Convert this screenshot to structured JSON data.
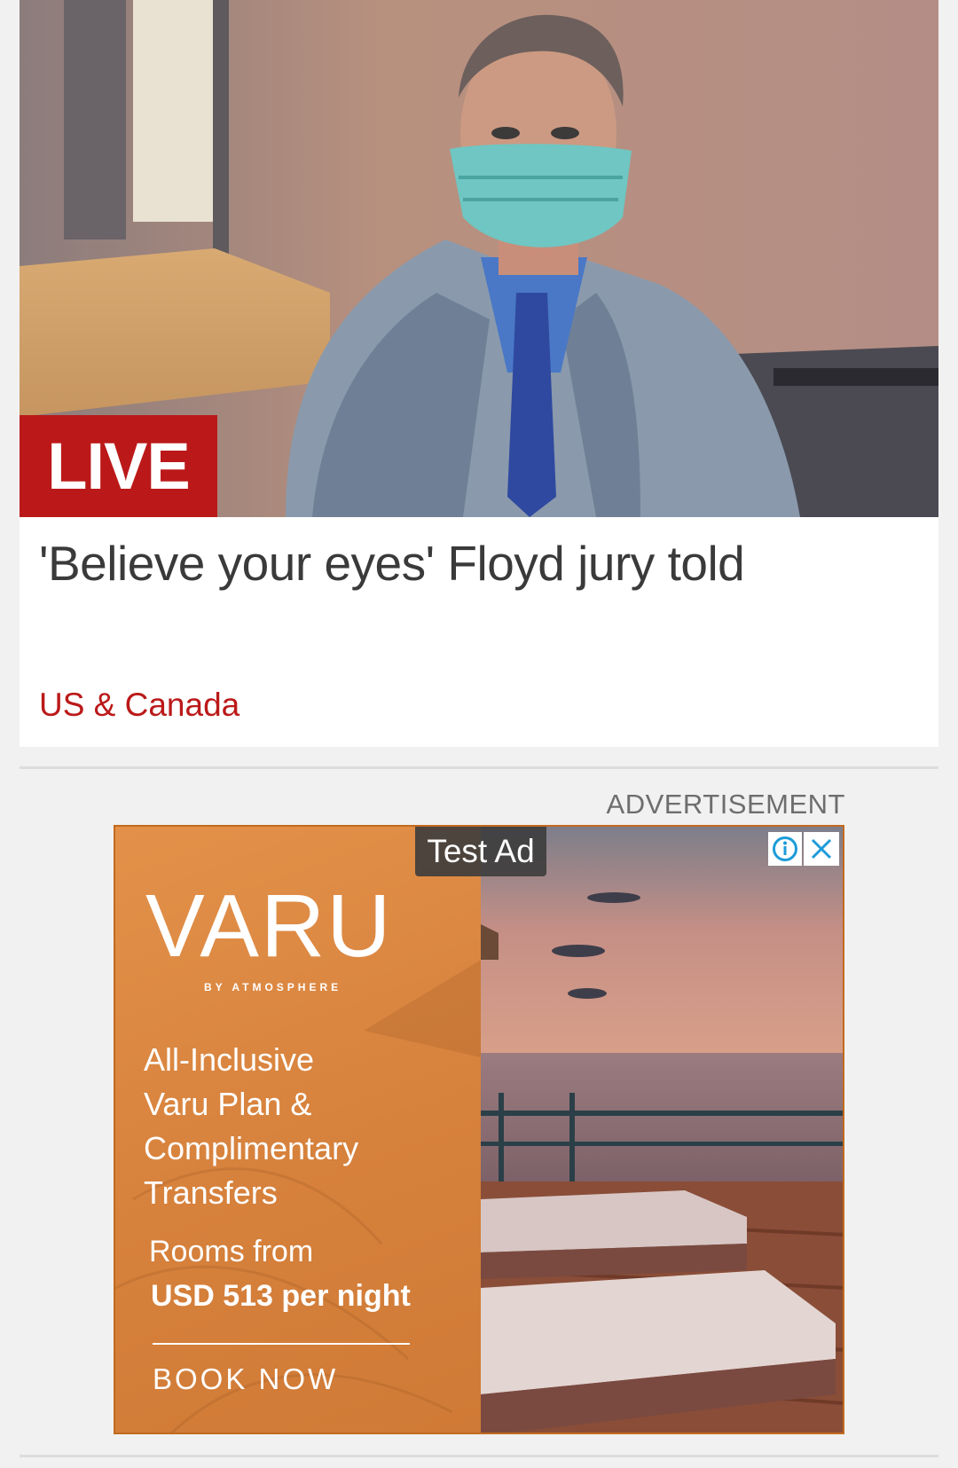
{
  "article": {
    "badge": "LIVE",
    "headline": "'Believe your eyes' Floyd jury told",
    "section": "US & Canada",
    "image_icon": "courtroom-sketch-image"
  },
  "advertisement": {
    "label": "ADVERTISEMENT",
    "test_label": "Test Ad",
    "info_icon": "info-icon",
    "close_icon": "close-icon",
    "brand": "VARU",
    "brand_sub": "BY ATMOSPHERE",
    "offer_lines": [
      "All-Inclusive",
      "Varu Plan &",
      "Complimentary",
      "Transfers"
    ],
    "rooms_text": "Rooms from",
    "price_text": "USD 513 per night",
    "cta": "BOOK NOW"
  },
  "colors": {
    "accent": "#bb1919",
    "background": "#f1f1f1",
    "ad_orange": "#d98a45"
  }
}
